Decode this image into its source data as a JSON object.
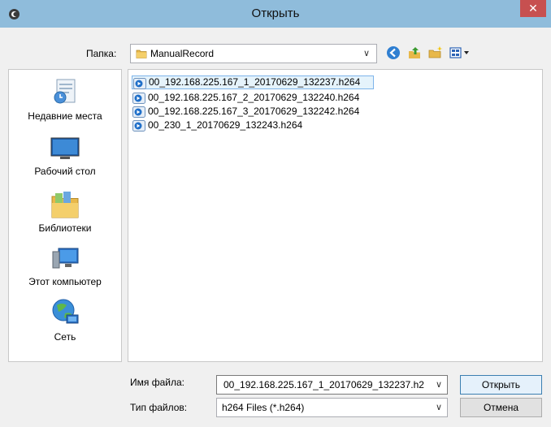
{
  "window": {
    "title": "Открыть",
    "close_glyph": "✕",
    "colors": {
      "titlebar": "#8fbcdb",
      "close": "#c75050",
      "selection": "#e5f3fb"
    }
  },
  "lookin": {
    "label": "Папка:",
    "value": "ManualRecord",
    "icon": "folder-icon"
  },
  "toolbar": {
    "icons": [
      "back-icon",
      "up-folder-icon",
      "new-folder-icon",
      "view-menu-icon"
    ]
  },
  "places": [
    {
      "label": "Недавние места",
      "icon": "recent-places-icon"
    },
    {
      "label": "Рабочий стол",
      "icon": "desktop-icon"
    },
    {
      "label": "Библиотеки",
      "icon": "libraries-icon"
    },
    {
      "label": "Этот компьютер",
      "icon": "computer-icon"
    },
    {
      "label": "Сеть",
      "icon": "network-icon"
    }
  ],
  "files": [
    {
      "name": "00_192.168.225.167_1_20170629_132237.h264",
      "selected": true
    },
    {
      "name": "00_192.168.225.167_2_20170629_132240.h264",
      "selected": false
    },
    {
      "name": "00_192.168.225.167_3_20170629_132242.h264",
      "selected": false
    },
    {
      "name": "00_230_1_20170629_132243.h264",
      "selected": false
    }
  ],
  "filename": {
    "label": "Имя файла:",
    "value": "00_192.168.225.167_1_20170629_132237.h2"
  },
  "filetype": {
    "label": "Тип файлов:",
    "value": "h264 Files (*.h264)"
  },
  "buttons": {
    "open": "Открыть",
    "cancel": "Отмена"
  }
}
